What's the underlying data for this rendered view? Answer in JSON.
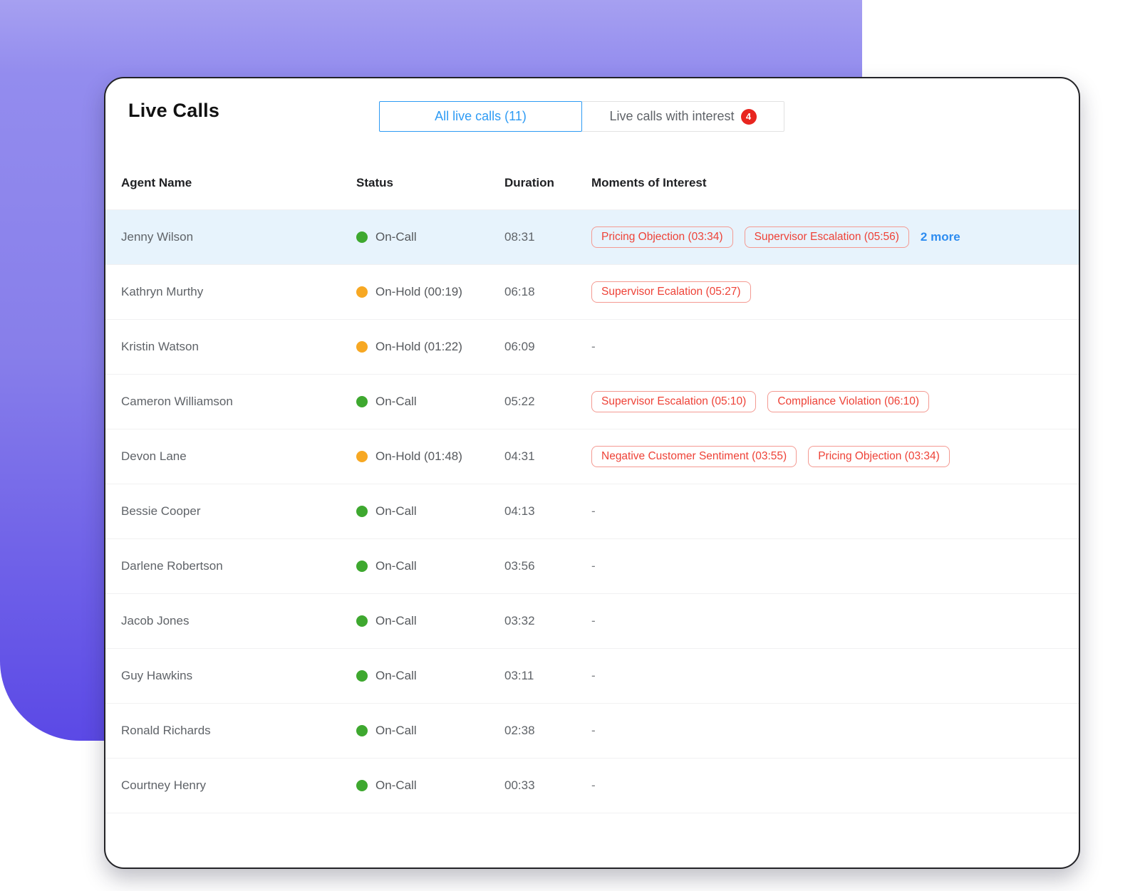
{
  "header": {
    "title": "Live Calls",
    "tabs": [
      {
        "label": "All live calls (11)",
        "active": true
      },
      {
        "label": "Live calls with interest",
        "badge": "4",
        "active": false
      }
    ]
  },
  "table": {
    "columns": [
      "Agent Name",
      "Status",
      "Duration",
      "Moments of Interest"
    ],
    "empty_placeholder": "-",
    "rows": [
      {
        "agent": "Jenny Wilson",
        "status": "On-Call",
        "status_type": "on-call",
        "duration": "08:31",
        "moments": [
          "Pricing Objection (03:34)",
          "Supervisor Escalation (05:56)"
        ],
        "more": "2 more",
        "highlighted": true
      },
      {
        "agent": "Kathryn Murthy",
        "status": "On-Hold (00:19)",
        "status_type": "on-hold",
        "duration": "06:18",
        "moments": [
          "Supervisor Ecalation (05:27)"
        ]
      },
      {
        "agent": "Kristin Watson",
        "status": "On-Hold (01:22)",
        "status_type": "on-hold",
        "duration": "06:09",
        "moments": []
      },
      {
        "agent": "Cameron Williamson",
        "status": "On-Call",
        "status_type": "on-call",
        "duration": "05:22",
        "moments": [
          "Supervisor Escalation (05:10)",
          "Compliance Violation (06:10)"
        ]
      },
      {
        "agent": "Devon Lane",
        "status": "On-Hold (01:48)",
        "status_type": "on-hold",
        "duration": "04:31",
        "moments": [
          "Negative Customer Sentiment (03:55)",
          "Pricing Objection (03:34)"
        ]
      },
      {
        "agent": "Bessie Cooper",
        "status": "On-Call",
        "status_type": "on-call",
        "duration": "04:13",
        "moments": []
      },
      {
        "agent": "Darlene Robertson",
        "status": "On-Call",
        "status_type": "on-call",
        "duration": "03:56",
        "moments": []
      },
      {
        "agent": "Jacob Jones",
        "status": "On-Call",
        "status_type": "on-call",
        "duration": "03:32",
        "moments": []
      },
      {
        "agent": "Guy Hawkins",
        "status": "On-Call",
        "status_type": "on-call",
        "duration": "03:11",
        "moments": []
      },
      {
        "agent": "Ronald Richards",
        "status": "On-Call",
        "status_type": "on-call",
        "duration": "02:38",
        "moments": []
      },
      {
        "agent": "Courtney Henry",
        "status": "On-Call",
        "status_type": "on-call",
        "duration": "00:33",
        "moments": []
      }
    ]
  },
  "colors": {
    "accent-blue": "#2e9bf4",
    "link-blue": "#2d8cf0",
    "badge-red-text": "#ee4237",
    "badge-red-border": "#f49a92",
    "dot-green": "#3ea82f",
    "dot-orange": "#f7a823",
    "row-highlight": "#e7f3fc",
    "tab-badge-red": "#e8251f",
    "purple-top": "#a6a0f1",
    "purple-mid": "#877eea",
    "purple-bottom": "#5b49e6"
  }
}
